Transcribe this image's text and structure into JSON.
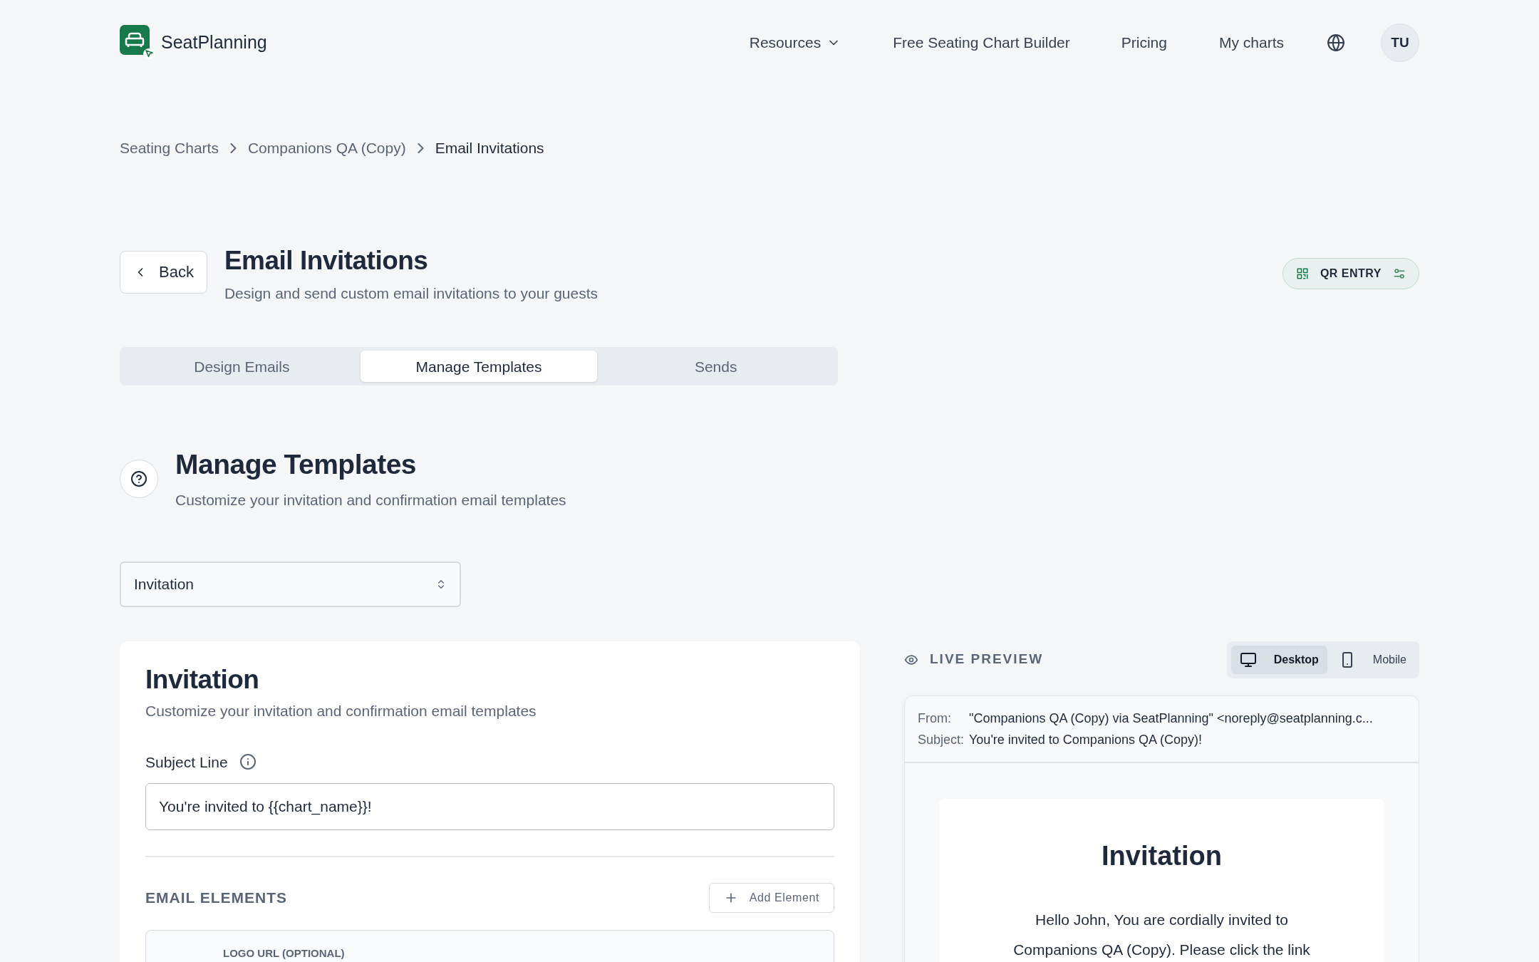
{
  "brand": {
    "name": "SeatPlanning"
  },
  "nav": [
    {
      "label": "Resources",
      "kind": "dropdown"
    },
    {
      "label": "Free Seating Chart Builder",
      "kind": "link"
    },
    {
      "label": "Pricing",
      "kind": "link"
    },
    {
      "label": "My charts",
      "kind": "link"
    }
  ],
  "avatar": {
    "initials": "TU"
  },
  "breadcrumb": [
    {
      "label": "Seating Charts",
      "current": false
    },
    {
      "label": "Companions QA (Copy)",
      "current": false
    },
    {
      "label": "Email Invitations",
      "current": true
    }
  ],
  "back_button": "Back",
  "page": {
    "title": "Email Invitations",
    "subtitle": "Design and send custom email invitations to your guests"
  },
  "qr_entry": "QR ENTRY",
  "tabs": [
    {
      "label": "Design Emails",
      "selected": false
    },
    {
      "label": "Manage Templates",
      "selected": true
    },
    {
      "label": "Sends",
      "selected": false
    }
  ],
  "section": {
    "title": "Manage Templates",
    "subtitle": "Customize your invitation and confirmation email templates"
  },
  "template_select": {
    "value": "Invitation"
  },
  "editor": {
    "title": "Invitation",
    "subtitle": "Customize your invitation and confirmation email templates",
    "subject_label": "Subject Line",
    "subject_value": "You're invited to {{chart_name}}!",
    "elements_heading": "EMAIL ELEMENTS",
    "add_button": "Add Element",
    "first_element_label": "LOGO URL (OPTIONAL)"
  },
  "preview": {
    "heading": "LIVE PREVIEW",
    "modes": [
      {
        "label": "Desktop",
        "kind": "desktop",
        "selected": true
      },
      {
        "label": "Mobile",
        "kind": "mobile",
        "selected": false
      }
    ],
    "from_label": "From:",
    "from_value": "\"Companions QA (Copy) via SeatPlanning\" <noreply@seatplanning.c...",
    "subject_label": "Subject:",
    "subject_value": "You're invited to Companions QA (Copy)!",
    "email_title": "Invitation",
    "email_body_lines": [
      "Hello John, You are cordially invited to",
      "Companions QA (Copy). Please click the link"
    ]
  }
}
